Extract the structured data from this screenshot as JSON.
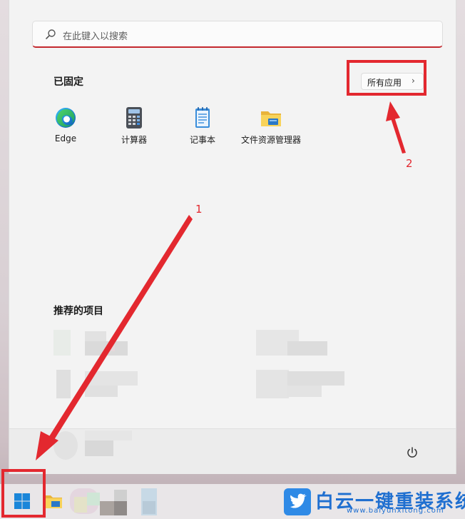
{
  "search": {
    "placeholder": "在此键入以搜索"
  },
  "pinned": {
    "title": "已固定",
    "all_apps_label": "所有应用",
    "apps": [
      {
        "label": "Edge",
        "icon": "edge-icon"
      },
      {
        "label": "计算器",
        "icon": "calculator-icon"
      },
      {
        "label": "记事本",
        "icon": "notepad-icon"
      },
      {
        "label": "文件资源管理器",
        "icon": "file-explorer-icon"
      }
    ]
  },
  "recommended": {
    "title": "推荐的项目"
  },
  "annotations": {
    "one": "1",
    "two": "2"
  },
  "watermark": {
    "title": "白云一键重装系统",
    "url": "www.baiyunxitong.com"
  },
  "colors": {
    "accent_red": "#e3282f",
    "search_underline": "#c4282e",
    "watermark_blue": "#1f6fd0"
  }
}
